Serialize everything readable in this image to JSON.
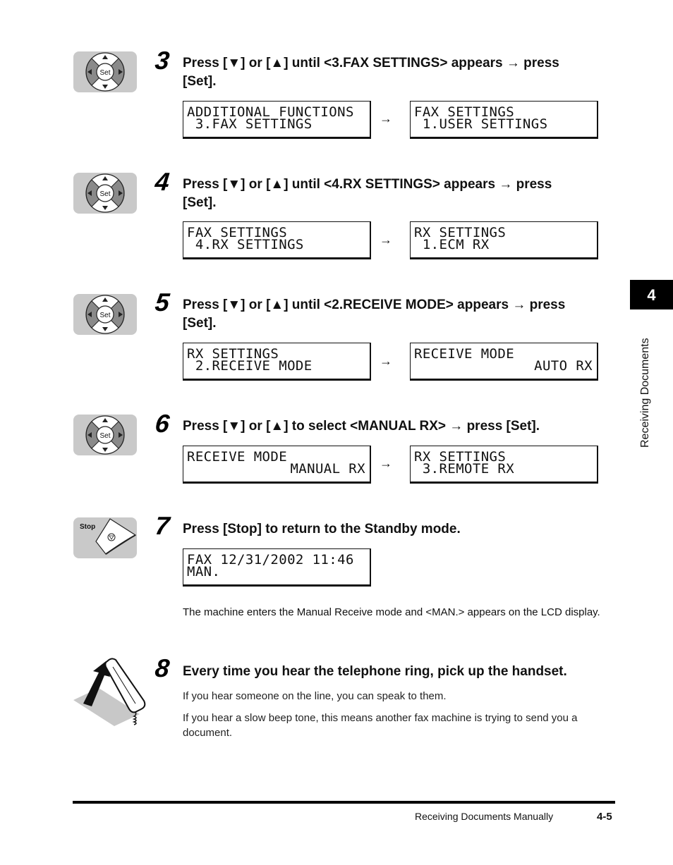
{
  "side_tab": {
    "chapter_number": "4",
    "chapter_title": "Receiving Documents"
  },
  "steps": [
    {
      "number": "3",
      "icon": "set-button-icon",
      "instruction_line1": "Press [▼] or [▲] until <3.FAX SETTINGS> appears → press",
      "instruction_line2": "[Set].",
      "lcd_before": {
        "line1": "ADDITIONAL FUNCTIONS",
        "line2": " 3.FAX SETTINGS"
      },
      "arrow": "→",
      "lcd_after": {
        "line1": "FAX SETTINGS",
        "line2": " 1.USER SETTINGS"
      }
    },
    {
      "number": "4",
      "icon": "set-button-icon",
      "instruction_line1": "Press [▼] or [▲] until <4.RX SETTINGS> appears → press",
      "instruction_line2": "[Set].",
      "lcd_before": {
        "line1": "FAX SETTINGS",
        "line2": " 4.RX SETTINGS"
      },
      "arrow": "→",
      "lcd_after": {
        "line1": "RX SETTINGS",
        "line2": " 1.ECM RX"
      }
    },
    {
      "number": "5",
      "icon": "set-button-icon",
      "instruction_line1": "Press [▼] or [▲] until <2.RECEIVE MODE> appears → press",
      "instruction_line2": "[Set].",
      "lcd_before": {
        "line1": "RX SETTINGS",
        "line2": " 2.RECEIVE MODE"
      },
      "arrow": "→",
      "lcd_after": {
        "line1": "RECEIVE MODE",
        "line2": "AUTO RX"
      }
    },
    {
      "number": "6",
      "icon": "set-button-icon",
      "instruction_line1": "Press [▼] or [▲] to select <MANUAL RX> → press [Set].",
      "lcd_before": {
        "line1": "RECEIVE MODE",
        "line2": "MANUAL RX"
      },
      "arrow": "→",
      "lcd_after": {
        "line1": "RX SETTINGS",
        "line2": " 3.REMOTE RX"
      }
    },
    {
      "number": "7",
      "icon": "stop-button-icon",
      "icon_label": "Stop",
      "instruction_line1": "Press [Stop] to return to the Standby mode.",
      "lcd": {
        "line1": "FAX 12/31/2002 11:46",
        "line2": "MAN."
      },
      "note": "The machine enters the Manual Receive mode and <MAN.> appears on the LCD display."
    },
    {
      "number": "8",
      "icon": "handset-pickup-icon",
      "instruction_line1": "Every time you hear the telephone ring, pick up the handset.",
      "note1": "If you hear someone on the line, you can speak to them.",
      "note2": "If you hear a slow beep tone, this means another fax machine is trying to send you a document."
    }
  ],
  "set_button_label": "Set",
  "footer": {
    "section_title": "Receiving Documents Manually",
    "page_number": "4-5"
  }
}
